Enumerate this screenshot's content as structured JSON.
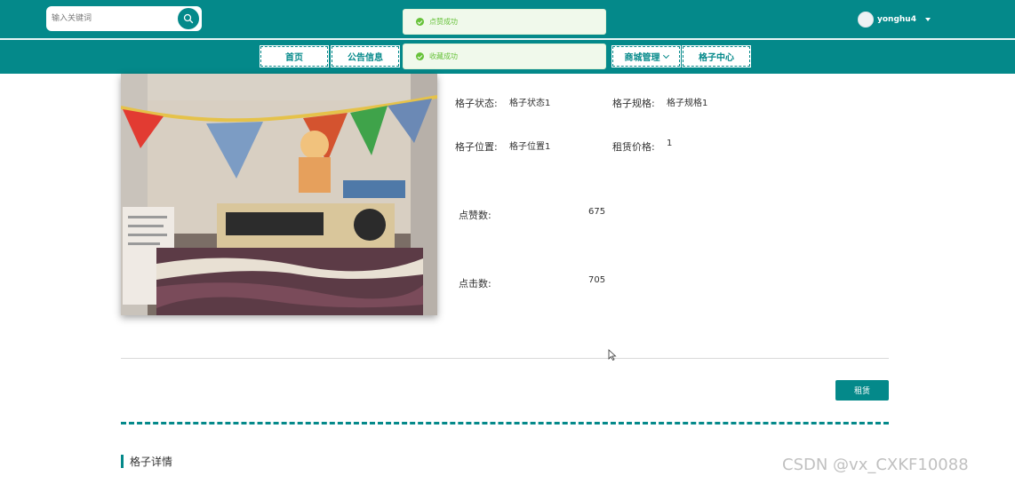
{
  "header": {
    "search": {
      "placeholder": "输入关键词"
    },
    "user": {
      "name": "yonghu4"
    }
  },
  "nav": {
    "items": [
      {
        "label": "首页"
      },
      {
        "label": "公告信息"
      },
      {
        "label": "商城管理"
      },
      {
        "label": "格子中心"
      }
    ]
  },
  "toasts": [
    {
      "text": "点赞成功"
    },
    {
      "text": "收藏成功"
    }
  ],
  "detail": {
    "status_label": "格子状态:",
    "status_value": "格子状态1",
    "spec_label": "格子规格:",
    "spec_value": "格子规格1",
    "location_label": "格子位置:",
    "location_value": "格子位置1",
    "price_label": "租赁价格:",
    "price_value": "1",
    "likes_label": "点赞数:",
    "likes_value": "675",
    "clicks_label": "点击数:",
    "clicks_value": "705",
    "rent_button": "租赁"
  },
  "section": {
    "title": "格子详情"
  },
  "watermark": "CSDN @vx_CXKF10088",
  "colors": {
    "primary": "#04898a",
    "success": "#67c23a"
  }
}
